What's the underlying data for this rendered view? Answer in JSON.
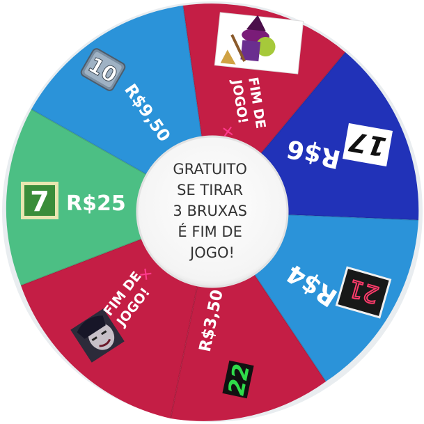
{
  "wheel": {
    "center_text": [
      "GRATUITO",
      "SE TIRAR",
      "3 BRUXAS",
      "É FIM DE",
      "JOGO!"
    ],
    "segments": [
      {
        "label": "R$9,50",
        "badge": "10",
        "color": "#2b93d9"
      },
      {
        "label": "FIM DE JOGO!",
        "mark": "✕",
        "color": "#c41e45",
        "image": "witch-image"
      },
      {
        "label": "R$6",
        "badge": "17",
        "color": "#2132b8"
      },
      {
        "label": "R$4",
        "badge": "21",
        "color": "#2b93d9"
      },
      {
        "label": "R$3,50",
        "badge": "22",
        "color": "#c41e45"
      },
      {
        "label": "FIM DE JOGO!",
        "mark": "✕",
        "color": "#c41e45",
        "image": "evil-queen-image"
      },
      {
        "label": "R$25",
        "badge": "7",
        "color": "#4cbf84"
      }
    ],
    "colors": {
      "pink_mark": "#ff3a8c",
      "badge_green": "#3a8d3a",
      "rim": "#eef1f3"
    }
  }
}
